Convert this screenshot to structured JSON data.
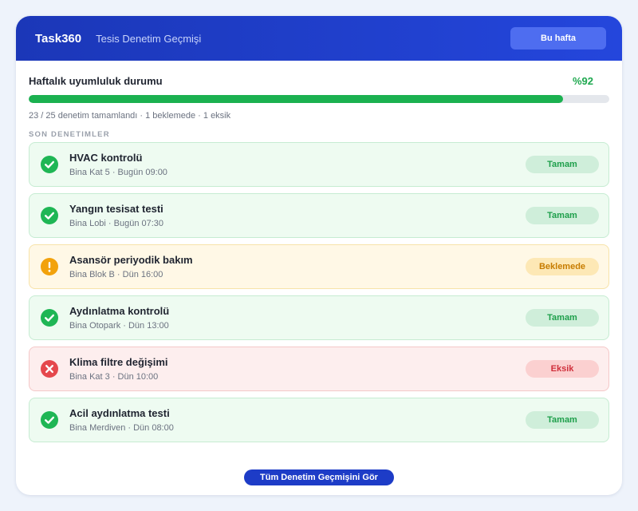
{
  "header": {
    "brand": "Task360",
    "subtitle": "Tesis Denetim Geçmişi",
    "week_button": "Bu hafta"
  },
  "summary": {
    "title": "Haftalık uyumluluk durumu",
    "percent_label": "%92",
    "progress_value": 0.92,
    "stats": "23 / 25 denetim tamamlandı · 1 beklemede · 1 eksik"
  },
  "section_label": "SON DENETIMLER",
  "inspections": [
    {
      "title": "HVAC kontrolü",
      "meta": "Bina Kat 5 · Bugün 09:00",
      "status": "ok",
      "badge": "Tamam",
      "icon": "check-circle-icon"
    },
    {
      "title": "Yangın tesisat testi",
      "meta": "Bina Lobi · Bugün 07:30",
      "status": "ok",
      "badge": "Tamam",
      "icon": "check-circle-icon"
    },
    {
      "title": "Asansör periyodik bakım",
      "meta": "Bina Blok B · Dün 16:00",
      "status": "pending",
      "badge": "Beklemede",
      "icon": "exclamation-circle-icon"
    },
    {
      "title": "Aydınlatma kontrolü",
      "meta": "Bina Otopark · Dün 13:00",
      "status": "ok",
      "badge": "Tamam",
      "icon": "check-circle-icon"
    },
    {
      "title": "Klima filtre değişimi",
      "meta": "Bina Kat 3 · Dün 10:00",
      "status": "missing",
      "badge": "Eksik",
      "icon": "x-circle-icon"
    },
    {
      "title": "Acil aydınlatma testi",
      "meta": "Bina Merdiven · Dün 08:00",
      "status": "ok",
      "badge": "Tamam",
      "icon": "check-circle-icon"
    }
  ],
  "footer": {
    "button": "Tüm Denetim Geçmişini Gör"
  },
  "colors": {
    "ok": "#1fb655",
    "pending": "#f2a20c",
    "missing": "#e5484d",
    "brand": "#1d3cc7"
  }
}
